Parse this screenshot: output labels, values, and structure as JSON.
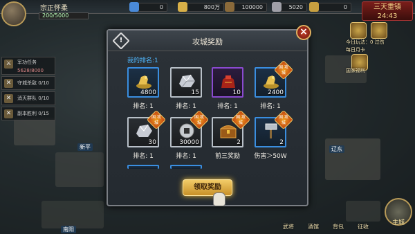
{
  "player": {
    "name": "宗正怀柔",
    "exp": "200/5000"
  },
  "resources": [
    {
      "value": "0",
      "color": "#4a8ad8"
    },
    {
      "value": "800万",
      "color": "#d8b048"
    },
    {
      "value": "100000",
      "color": "#8a6a3a"
    },
    {
      "value": "5020",
      "color": "#a0a0a8"
    },
    {
      "value": "0",
      "color": "#c8a040"
    }
  ],
  "city_tag": {
    "line1": "三天重镇",
    "line2": "24:43"
  },
  "quests": [
    {
      "title": "军功任务",
      "sub": "5628/8000"
    },
    {
      "title": "守城杀敌 0/10"
    },
    {
      "title": "消灭群队 0/10"
    },
    {
      "title": "副本胜利 0/15"
    }
  ],
  "side": [
    {
      "label": "今日玩法：0 过伤"
    },
    {
      "label": "每日月卡"
    },
    {
      "label": "国家福利"
    }
  ],
  "map_labels": [
    "新平",
    "辽东",
    "南阳"
  ],
  "bottom_nav": [
    "武将",
    "酒馆",
    "背包",
    "征收"
  ],
  "main_city_btn": "主城",
  "modal": {
    "title": "攻城奖励",
    "rank_text": "我的排名:1",
    "claim_label": "领取奖励",
    "close_symbol": "×",
    "info_symbol": "!"
  },
  "rewards": [
    {
      "qty": "4800",
      "label": "排名: 1",
      "rarity": "blue",
      "icon": "gold-horse-icon",
      "badge": false
    },
    {
      "qty": "15",
      "label": "排名: 1",
      "rarity": "white",
      "icon": "silver-ore-icon",
      "badge": false
    },
    {
      "qty": "10",
      "label": "排名: 1",
      "rarity": "purple",
      "icon": "red-pouch-icon",
      "badge": false
    },
    {
      "qty": "2400",
      "label": "排名: 1",
      "rarity": "blue",
      "icon": "gold-horse-icon",
      "badge": true,
      "badge_text": "国\n攻城"
    },
    {
      "qty": "30",
      "label": "排名: 1",
      "rarity": "white",
      "icon": "silver-ore-icon",
      "badge": true,
      "badge_text": "国\n攻城"
    },
    {
      "qty": "30000",
      "label": "排名: 1",
      "rarity": "white",
      "icon": "coin-icon",
      "badge": true,
      "badge_text": "国\n攻城"
    },
    {
      "qty": "2",
      "label": "前三奖励",
      "rarity": "white",
      "icon": "treasure-chest-icon",
      "badge": true,
      "badge_text": "国\n攻城"
    },
    {
      "qty": "2",
      "label": "伤害＞50W",
      "rarity": "blue",
      "icon": "war-hammer-icon",
      "badge": true,
      "badge_text": "国\n攻城"
    }
  ]
}
